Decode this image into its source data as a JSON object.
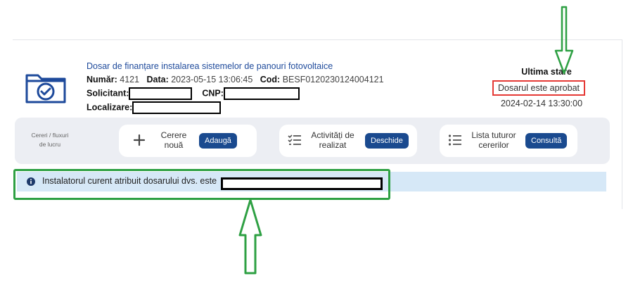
{
  "dossier": {
    "title": "Dosar de finanțare instalarea sistemelor de panouri fotovoltaice",
    "number_label": "Număr:",
    "number_value": "4121",
    "date_label": "Data:",
    "date_value": "2023-05-15 13:06:45",
    "code_label": "Cod:",
    "code_value": "BESF0120230124004121",
    "applicant_label": "Solicitant:",
    "cnp_label": "CNP:",
    "location_label": "Localizare:"
  },
  "status": {
    "label": "Ultima stare",
    "value": "Dosarul este aprobat",
    "date": "2024-02-14 13:30:00",
    "highlight_color": "#e53935"
  },
  "toolbar": {
    "section_label": "Cereri / fluxuri de lucru",
    "actions": [
      {
        "icon": "plus-icon",
        "label": "Cerere nouă",
        "button": "Adaugă"
      },
      {
        "icon": "checklist-icon",
        "label": "Activități de realizat",
        "button": "Deschide"
      },
      {
        "icon": "list-icon",
        "label": "Lista tuturor cererilor",
        "button": "Consultă"
      }
    ],
    "button_color": "#1a4a8f"
  },
  "info": {
    "icon": "info-icon",
    "text": "Instalatorul curent atribuit dosarului dvs. este"
  },
  "annotations": {
    "arrow_color": "#2ea043"
  }
}
